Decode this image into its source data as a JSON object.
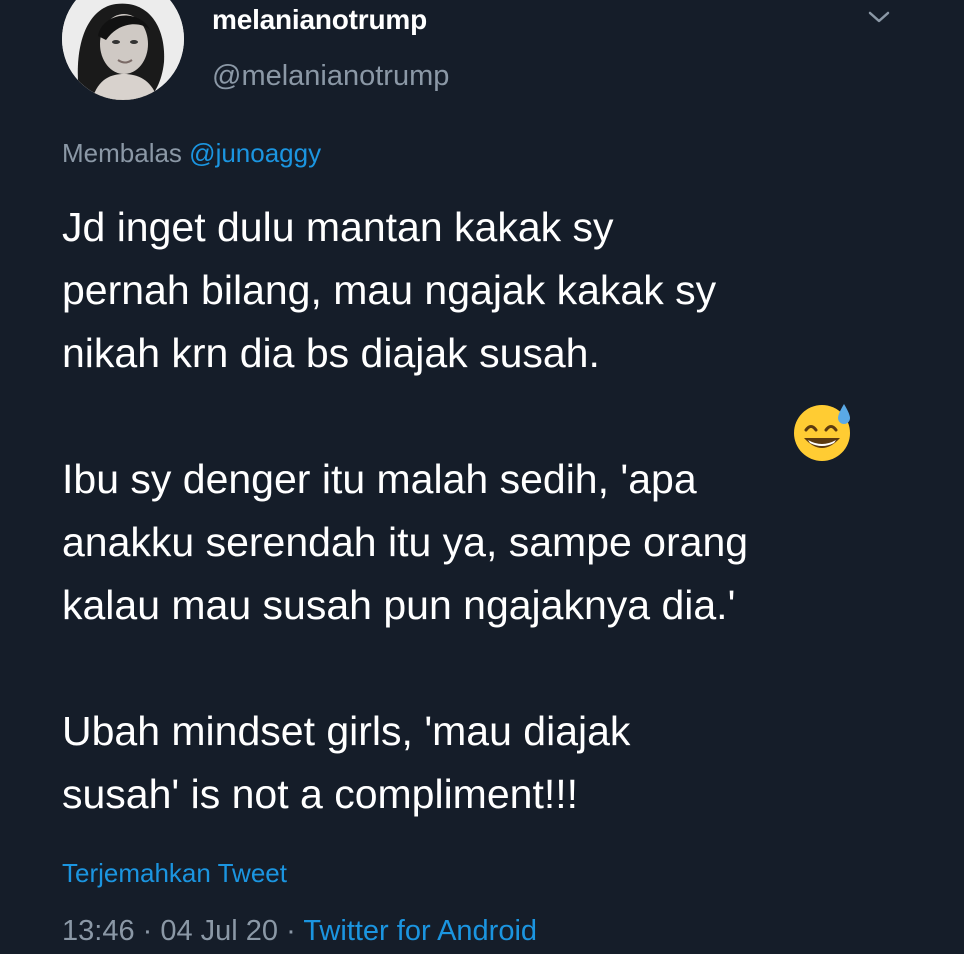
{
  "user": {
    "display_name": "melanianotrump",
    "handle": "@melanianotrump",
    "avatar_icon": "profile-photo"
  },
  "menu_icon": "chevron-down-icon",
  "reply": {
    "prefix": "Membalas",
    "mention": "@junoaggy"
  },
  "body": {
    "p1_lines": [
      "Jd inget dulu mantan kakak sy",
      "pernah bilang, mau ngajak kakak sy",
      "nikah krn dia bs diajak susah."
    ],
    "emoji": "smiling-face-with-sweat-emoji",
    "p2_lines": [
      "Ibu sy denger itu malah sedih, 'apa",
      "anakku serendah itu ya, sampe orang",
      "kalau mau susah pun ngajaknya dia.'"
    ],
    "p3_lines": [
      "Ubah mindset girls, 'mau diajak",
      "susah' is not a compliment!!!"
    ]
  },
  "translate_label": "Terjemahkan Tweet",
  "meta": {
    "time": "13:46",
    "separator": " · ",
    "date": "04 Jul 20",
    "source": "Twitter for Android"
  },
  "colors": {
    "background": "#151d29",
    "text": "#ffffff",
    "secondary": "#8b98a6",
    "link": "#1b95e0"
  }
}
